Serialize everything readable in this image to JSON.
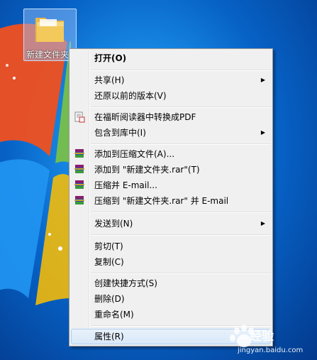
{
  "desktop": {
    "file": {
      "label": "新建文件夹"
    }
  },
  "context_menu": {
    "items": [
      {
        "label": "打开(O)",
        "bold": true
      },
      {
        "label": "共享(H)",
        "submenu": true
      },
      {
        "label": "还原以前的版本(V)"
      },
      {
        "label": "在福昕阅读器中转换成PDF",
        "icon": "pdf-convert-icon"
      },
      {
        "label": "包含到库中(I)",
        "submenu": true
      },
      {
        "label": "添加到压缩文件(A)...",
        "icon": "winrar-icon"
      },
      {
        "label": "添加到 \"新建文件夹.rar\"(T)",
        "icon": "winrar-icon"
      },
      {
        "label": "压缩并 E-mail...",
        "icon": "winrar-icon"
      },
      {
        "label": "压缩到 \"新建文件夹.rar\" 并 E-mail",
        "icon": "winrar-icon"
      },
      {
        "label": "发送到(N)",
        "submenu": true
      },
      {
        "label": "剪切(T)"
      },
      {
        "label": "复制(C)"
      },
      {
        "label": "创建快捷方式(S)"
      },
      {
        "label": "删除(D)"
      },
      {
        "label": "重命名(M)"
      },
      {
        "label": "属性(R)",
        "highlighted": true
      }
    ]
  },
  "watermark": {
    "text": "经验",
    "url": "jingyan.baidu.com"
  }
}
